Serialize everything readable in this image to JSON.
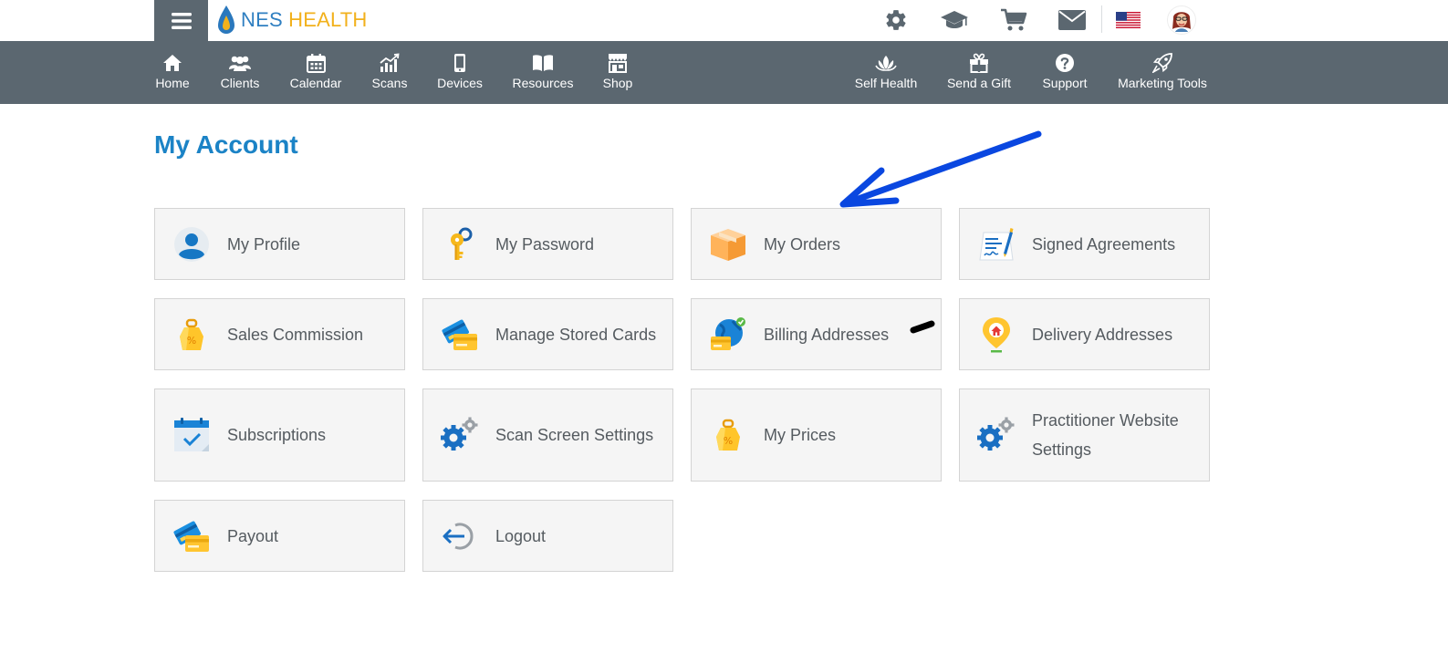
{
  "logo": {
    "part1": "NES",
    "part2": "HEALTH"
  },
  "top_icons": [
    "gear-icon",
    "graduation-cap-icon",
    "cart-icon",
    "envelope-icon",
    "us-flag-icon",
    "user-avatar"
  ],
  "nav": {
    "left": [
      {
        "label": "Home",
        "icon": "home-icon"
      },
      {
        "label": "Clients",
        "icon": "clients-icon"
      },
      {
        "label": "Calendar",
        "icon": "calendar-icon"
      },
      {
        "label": "Scans",
        "icon": "scans-icon"
      },
      {
        "label": "Devices",
        "icon": "devices-icon"
      },
      {
        "label": "Resources",
        "icon": "resources-icon"
      },
      {
        "label": "Shop",
        "icon": "shop-icon"
      }
    ],
    "right": [
      {
        "label": "Self Health",
        "icon": "lotus-icon"
      },
      {
        "label": "Send a Gift",
        "icon": "gift-icon"
      },
      {
        "label": "Support",
        "icon": "support-icon"
      },
      {
        "label": "Marketing Tools",
        "icon": "rocket-icon"
      }
    ]
  },
  "page": {
    "title": "My Account"
  },
  "tiles": [
    {
      "label": "My Profile",
      "icon": "profile-icon"
    },
    {
      "label": "My Password",
      "icon": "key-icon"
    },
    {
      "label": "My Orders",
      "icon": "box-icon"
    },
    {
      "label": "Signed Agreements",
      "icon": "agreement-icon"
    },
    {
      "label": "Sales Commission",
      "icon": "price-tag-icon"
    },
    {
      "label": "Manage Stored Cards",
      "icon": "cards-icon"
    },
    {
      "label": "Billing Addresses",
      "icon": "globe-card-icon"
    },
    {
      "label": "Delivery Addresses",
      "icon": "location-pin-icon"
    },
    {
      "label": "Subscriptions",
      "icon": "calendar-check-icon"
    },
    {
      "label": "Scan Screen Settings",
      "icon": "gears-icon"
    },
    {
      "label": "My Prices",
      "icon": "price-tag-icon"
    },
    {
      "label": "Practitioner Website Settings",
      "icon": "gears-icon"
    },
    {
      "label": "Payout",
      "icon": "cards-icon"
    },
    {
      "label": "Logout",
      "icon": "logout-icon"
    }
  ],
  "colors": {
    "nav_bg": "#5b6770",
    "title_blue": "#1b83c6",
    "tile_bg": "#f5f5f5",
    "tile_border": "#d4d4d4",
    "annotation_arrow": "#0a47e0"
  }
}
